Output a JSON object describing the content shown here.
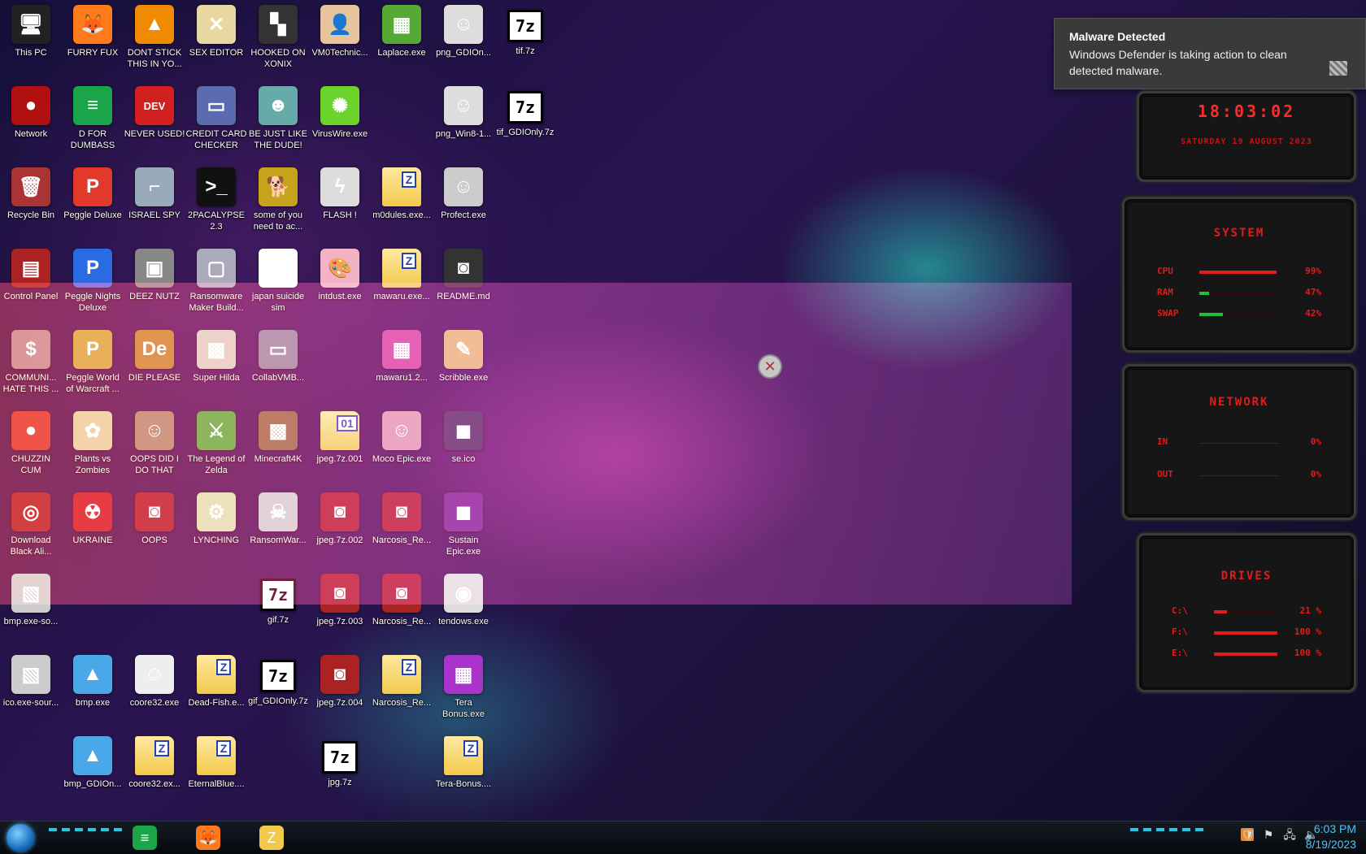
{
  "desktop_icons": [
    {
      "label": "This PC",
      "glyph": "pc",
      "color": "#222"
    },
    {
      "label": "FURRY FUX",
      "glyph": "firefox",
      "color": "#ff7a1a"
    },
    {
      "label": "DONT STICK THIS IN YO...",
      "glyph": "cone",
      "color": "#f08a00"
    },
    {
      "label": "SEX EDITOR",
      "glyph": "hex",
      "color": "#e8d7a0"
    },
    {
      "label": "HOOKED ON XONIX",
      "glyph": "xonix",
      "color": "#333"
    },
    {
      "label": "VM0Technic...",
      "glyph": "user",
      "color": "#e6c49c"
    },
    {
      "label": "Laplace.exe",
      "glyph": "noise",
      "color": "#5a3"
    },
    {
      "label": "png_GDIOn...",
      "glyph": "anime",
      "color": "#ddd"
    },
    {
      "label": "tif.7z",
      "glyph": "7z",
      "color": "#fff"
    },
    {
      "label": "Network",
      "glyph": "orb",
      "color": "#b01010"
    },
    {
      "label": "D FOR DUMBASS",
      "glyph": "doc",
      "color": "#1aa54a"
    },
    {
      "label": "NEVER USED!",
      "glyph": "dev",
      "color": "#d21f1f"
    },
    {
      "label": "CREDIT CARD CHECKER",
      "glyph": "card",
      "color": "#5a6bb0"
    },
    {
      "label": "BE JUST LIKE THE DUDE!",
      "glyph": "dude",
      "color": "#6aa"
    },
    {
      "label": "VirusWire.exe",
      "glyph": "lime",
      "color": "#6bd32c"
    },
    {
      "label": "png_Win8-1...",
      "glyph": "anime",
      "color": "#ddd"
    },
    {
      "label": "tif_GDIOnly.7z",
      "glyph": "7z",
      "color": "#fff"
    },
    {
      "label": "Recycle Bin",
      "glyph": "bin",
      "color": "#a33"
    },
    {
      "label": "Peggle Deluxe",
      "glyph": "P",
      "color": "#e23a2a"
    },
    {
      "label": "ISRAEL SPY",
      "glyph": "spy",
      "color": "#9ab"
    },
    {
      "label": "2PACALYPSE 2.3",
      "glyph": "cmd",
      "color": "#111"
    },
    {
      "label": "some of you need to ac...",
      "glyph": "dog",
      "color": "#c8a21a"
    },
    {
      "label": "FLASH !",
      "glyph": "flash",
      "color": "#ddd"
    },
    {
      "label": "m0dules.exe...",
      "glyph": "folder",
      "color": "#f3c94b"
    },
    {
      "label": "Profect.exe",
      "glyph": "anime",
      "color": "#ccc"
    },
    {
      "label": "Control Panel",
      "glyph": "panel",
      "color": "#a22"
    },
    {
      "label": "Peggle Nights Deluxe",
      "glyph": "P",
      "color": "#2a6ae2"
    },
    {
      "label": "DEEZ NUTZ",
      "glyph": "stack",
      "color": "#888"
    },
    {
      "label": "Ransomware Maker Build...",
      "glyph": "win",
      "color": "#aab"
    },
    {
      "label": "japan suicide sim",
      "glyph": "file",
      "color": "#fff"
    },
    {
      "label": "intdust.exe",
      "glyph": "palette",
      "color": "#f2b3c6"
    },
    {
      "label": "mawaru.exe...",
      "glyph": "folder",
      "color": "#f3c94b"
    },
    {
      "label": "README.md",
      "glyph": "rm",
      "color": "#333"
    },
    {
      "label": "COMMUNI... HATE THIS ...",
      "glyph": "money",
      "color": "#b88"
    },
    {
      "label": "Peggle World of Warcraft ...",
      "glyph": "P",
      "color": "#d8a33a"
    },
    {
      "label": "DIE PLEASE",
      "glyph": "De",
      "color": "#c7842a"
    },
    {
      "label": "Super Hilda",
      "glyph": "pixel",
      "color": "#dcb"
    },
    {
      "label": "CollabVMB...",
      "glyph": "monitor",
      "color": "#889"
    },
    {
      "label": "mawaru1.2...",
      "glyph": "noise",
      "color": "#d24a9a"
    },
    {
      "label": "Scribble.exe",
      "glyph": "scribble",
      "color": "#e8b36a"
    },
    {
      "label": "CHUZZIN CUM",
      "glyph": "chuzzle",
      "color": "#e23a2a"
    },
    {
      "label": "Plants vs Zombies",
      "glyph": "flower",
      "color": "#eacd9a"
    },
    {
      "label": "OOPS DID I DO THAT",
      "glyph": "portrait",
      "color": "#a86"
    },
    {
      "label": "The Legend of Zelda",
      "glyph": "link",
      "color": "#3a3"
    },
    {
      "label": "Minecraft4K",
      "glyph": "block",
      "color": "#8a6a3a"
    },
    {
      "label": "jpeg.7z.001",
      "glyph": "folder01",
      "color": "#f3c94b"
    },
    {
      "label": "Moco Epic.exe",
      "glyph": "anime",
      "color": "#d9a"
    },
    {
      "label": "se.ico",
      "glyph": "dark",
      "color": "#335"
    },
    {
      "label": "Download Black Ali...",
      "glyph": "ring",
      "color": "#a22"
    },
    {
      "label": "UKRAINE",
      "glyph": "radiation",
      "color": "#d21f1f"
    },
    {
      "label": "OOPS",
      "glyph": "rm",
      "color": "#a22"
    },
    {
      "label": "LYNCHING",
      "glyph": "gear",
      "color": "#dda"
    },
    {
      "label": "RansomWar...",
      "glyph": "skull",
      "color": "#ccc"
    },
    {
      "label": "jpeg.7z.002",
      "glyph": "rm",
      "color": "#a22"
    },
    {
      "label": "Narcosis_Re...",
      "glyph": "rm",
      "color": "#a22"
    },
    {
      "label": "Sustain Epic.exe",
      "glyph": "dark",
      "color": "#6a2a8a"
    },
    {
      "label": "bmp.exe-so...",
      "glyph": "doc2",
      "color": "#ccc"
    },
    {
      "label": "gif.7z",
      "glyph": "7z",
      "color": "#fff"
    },
    {
      "label": "jpeg.7z.003",
      "glyph": "rm",
      "color": "#a22"
    },
    {
      "label": "Narcosis_Re...",
      "glyph": "rm",
      "color": "#a22"
    },
    {
      "label": "tendows.exe",
      "glyph": "disc",
      "color": "#ddd"
    },
    {
      "label": "ico.exe-sour...",
      "glyph": "doc2",
      "color": "#ccc"
    },
    {
      "label": "bmp.exe",
      "glyph": "image",
      "color": "#4aa8e8"
    },
    {
      "label": "coore32.exe",
      "glyph": "anime",
      "color": "#eee"
    },
    {
      "label": "Dead-Fish.e...",
      "glyph": "folder",
      "color": "#f3c94b"
    },
    {
      "label": "gif_GDIOnly.7z",
      "glyph": "7z",
      "color": "#fff"
    },
    {
      "label": "jpeg.7z.004",
      "glyph": "rm",
      "color": "#a22"
    },
    {
      "label": "Narcosis_Re...",
      "glyph": "folder",
      "color": "#f3c94b"
    },
    {
      "label": "Tera Bonus.exe",
      "glyph": "noise",
      "color": "#a3c"
    },
    {
      "label": "bmp_GDIOn...",
      "glyph": "image",
      "color": "#4aa8e8"
    },
    {
      "label": "coore32.ex...",
      "glyph": "folder",
      "color": "#f3c94b"
    },
    {
      "label": "EternalBlue....",
      "glyph": "folder",
      "color": "#f3c94b"
    },
    {
      "label": "jpg.7z",
      "glyph": "7z",
      "color": "#fff"
    },
    {
      "label": "Tera-Bonus....",
      "glyph": "folder",
      "color": "#f3c94b"
    }
  ],
  "toast": {
    "title": "Malware Detected",
    "body": "Windows Defender is taking action to clean detected malware."
  },
  "clock_widget": {
    "time": "18:03:02",
    "date": "SATURDAY 19 AUGUST 2023"
  },
  "system_widget": {
    "title": "SYSTEM",
    "rows": [
      {
        "label": "CPU",
        "value": "99%",
        "level": 0.99,
        "color": "#e21b1b"
      },
      {
        "label": "RAM",
        "value": "47%",
        "level": 0.12,
        "color": "#1fbf3a"
      },
      {
        "label": "SWAP",
        "value": "42%",
        "level": 0.3,
        "color": "#1fbf3a"
      }
    ]
  },
  "network_widget": {
    "title": "NETWORK",
    "rows": [
      {
        "label": "IN",
        "value": "0%"
      },
      {
        "label": "OUT",
        "value": "0%"
      }
    ]
  },
  "drives_widget": {
    "title": "DRIVES",
    "rows": [
      {
        "label": "C:\\",
        "value": "21 %",
        "level": 0.21
      },
      {
        "label": "F:\\",
        "value": "100 %",
        "level": 1.0
      },
      {
        "label": "E:\\",
        "value": "100 %",
        "level": 1.0
      }
    ]
  },
  "taskbar": {
    "apps": [
      {
        "name": "notes",
        "glyph": "doc",
        "color": "#1aa54a"
      },
      {
        "name": "firefox",
        "glyph": "firefox",
        "color": "#ff7a1a"
      },
      {
        "name": "explorer",
        "glyph": "folder",
        "color": "#f3c94b"
      }
    ],
    "clock_time": "6:03 PM",
    "clock_date": "8/19/2023"
  }
}
